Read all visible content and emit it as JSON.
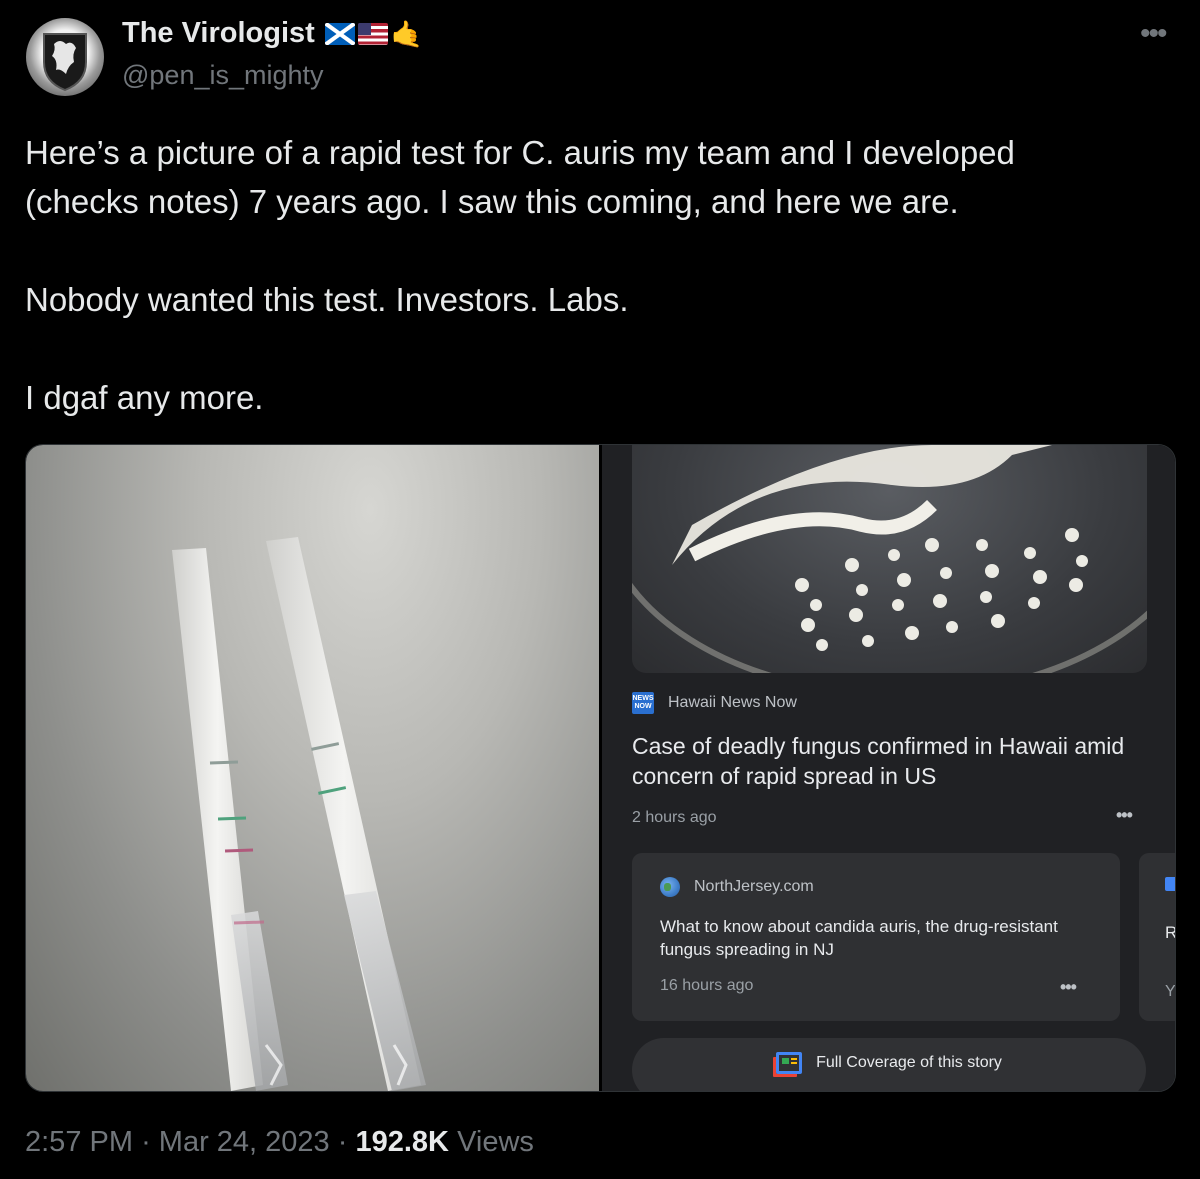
{
  "author": {
    "name": "The Virologist",
    "handle": "@pen_is_mighty",
    "flag_icons": [
      "scotland-flag-icon",
      "us-flag-icon",
      "call-me-hand-icon"
    ]
  },
  "tweet": {
    "lines": [
      "Here’s a picture of a rapid test for C. auris my team and I developed",
      "(checks notes) 7 years ago. I saw this coming, and here we are.",
      "Nobody wanted this test. Investors. Labs.",
      "I dgaf any more."
    ]
  },
  "media": {
    "news_card": {
      "logo_text": "NEWS NOW",
      "source": "Hawaii News Now",
      "headline": "Case of deadly fungus confirmed in Hawaii amid concern of rapid spread in US",
      "time_ago": "2 hours ago",
      "related": {
        "source": "NorthJersey.com",
        "title": "What to know about candida auris, the drug-resistant fungus spreading in NJ",
        "time_ago": "16 hours ago"
      },
      "next_card_fragment": {
        "title_start": "R",
        "time_start": "Y"
      },
      "full_coverage_label": "Full Coverage of this story"
    }
  },
  "footer": {
    "time": "2:57 PM",
    "separator": "·",
    "date": "Mar 24, 2023",
    "views_count": "192.8K",
    "views_label": "Views"
  },
  "colors": {
    "background": "#000000",
    "text_primary": "#e7e9ea",
    "text_secondary": "#71767b",
    "news_panel": "#202124"
  }
}
